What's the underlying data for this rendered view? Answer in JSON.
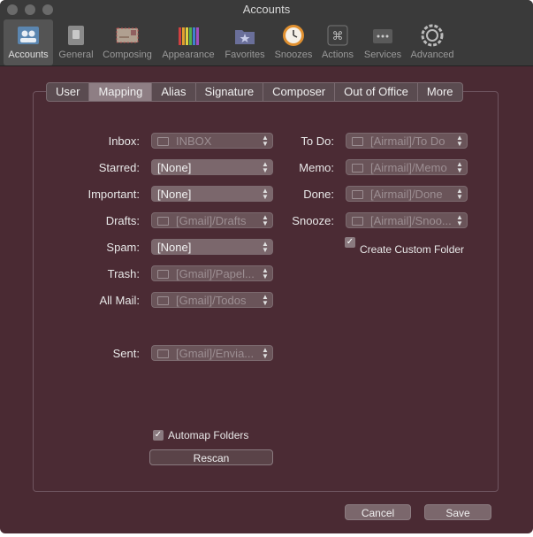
{
  "window": {
    "title": "Accounts"
  },
  "toolbar": {
    "items": [
      {
        "label": "Accounts",
        "icon": "accounts-icon"
      },
      {
        "label": "General",
        "icon": "general-icon"
      },
      {
        "label": "Composing",
        "icon": "composing-icon"
      },
      {
        "label": "Appearance",
        "icon": "appearance-icon"
      },
      {
        "label": "Favorites",
        "icon": "favorites-icon"
      },
      {
        "label": "Snoozes",
        "icon": "snoozes-icon"
      },
      {
        "label": "Actions",
        "icon": "actions-icon"
      },
      {
        "label": "Services",
        "icon": "services-icon"
      },
      {
        "label": "Advanced",
        "icon": "advanced-icon"
      }
    ],
    "active": "Accounts"
  },
  "tabs": [
    "User",
    "Mapping",
    "Alias",
    "Signature",
    "Composer",
    "Out of Office",
    "More"
  ],
  "active_tab": "Mapping",
  "left_mappings": [
    {
      "label": "Inbox:",
      "value": "INBOX",
      "folder": true,
      "enabled": false
    },
    {
      "label": "Starred:",
      "value": "[None]",
      "folder": false,
      "enabled": true
    },
    {
      "label": "Important:",
      "value": "[None]",
      "folder": false,
      "enabled": true
    },
    {
      "label": "Drafts:",
      "value": "[Gmail]/Drafts",
      "folder": true,
      "enabled": false
    },
    {
      "label": "Spam:",
      "value": "[None]",
      "folder": false,
      "enabled": true
    },
    {
      "label": "Trash:",
      "value": "[Gmail]/Papel...",
      "folder": true,
      "enabled": false
    },
    {
      "label": "All Mail:",
      "value": "[Gmail]/Todos",
      "folder": true,
      "enabled": false
    },
    {
      "label": "Sent:",
      "value": "[Gmail]/Envia...",
      "folder": true,
      "enabled": false
    }
  ],
  "right_mappings": [
    {
      "label": "To Do:",
      "value": "[Airmail]/To Do",
      "folder": true,
      "enabled": false
    },
    {
      "label": "Memo:",
      "value": "[Airmail]/Memo",
      "folder": true,
      "enabled": false
    },
    {
      "label": "Done:",
      "value": "[Airmail]/Done",
      "folder": true,
      "enabled": false
    },
    {
      "label": "Snooze:",
      "value": "[Airmail]/Snoo...",
      "folder": true,
      "enabled": false
    }
  ],
  "custom_folder": {
    "label": "Create Custom Folder",
    "checked": true
  },
  "automap": {
    "label": "Automap Folders",
    "checked": true
  },
  "rescan_label": "Rescan",
  "cancel_label": "Cancel",
  "save_label": "Save",
  "check_glyph": "✓"
}
